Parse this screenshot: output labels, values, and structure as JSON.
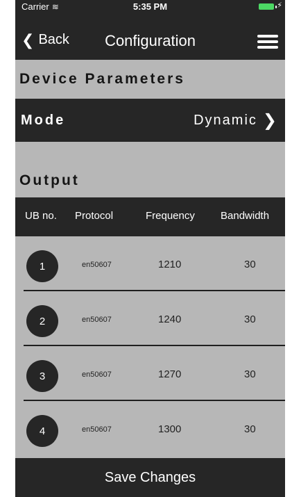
{
  "status": {
    "carrier": "Carrier",
    "time": "5:35 PM"
  },
  "nav": {
    "back_label": "Back",
    "title": "Configuration"
  },
  "device": {
    "title": "Device Parameters",
    "mode_label": "Mode",
    "mode_value": "Dynamic"
  },
  "output": {
    "title": "Output",
    "headers": [
      "UB no.",
      "Protocol",
      "Frequency",
      "Bandwidth"
    ],
    "rows": [
      {
        "ub": "1",
        "protocol": "en50607",
        "frequency": "1210",
        "bandwidth": "30"
      },
      {
        "ub": "2",
        "protocol": "en50607",
        "frequency": "1240",
        "bandwidth": "30"
      },
      {
        "ub": "3",
        "protocol": "en50607",
        "frequency": "1270",
        "bandwidth": "30"
      },
      {
        "ub": "4",
        "protocol": "en50607",
        "frequency": "1300",
        "bandwidth": "30"
      }
    ]
  },
  "save_label": "Save Changes",
  "colors": {
    "dark": "#262626",
    "panel": "#b7b7b7",
    "battery": "#4cd964"
  },
  "icons": [
    "wifi-icon",
    "battery-icon",
    "back-chevron-icon",
    "hamburger-menu-icon",
    "chevron-right-icon"
  ]
}
